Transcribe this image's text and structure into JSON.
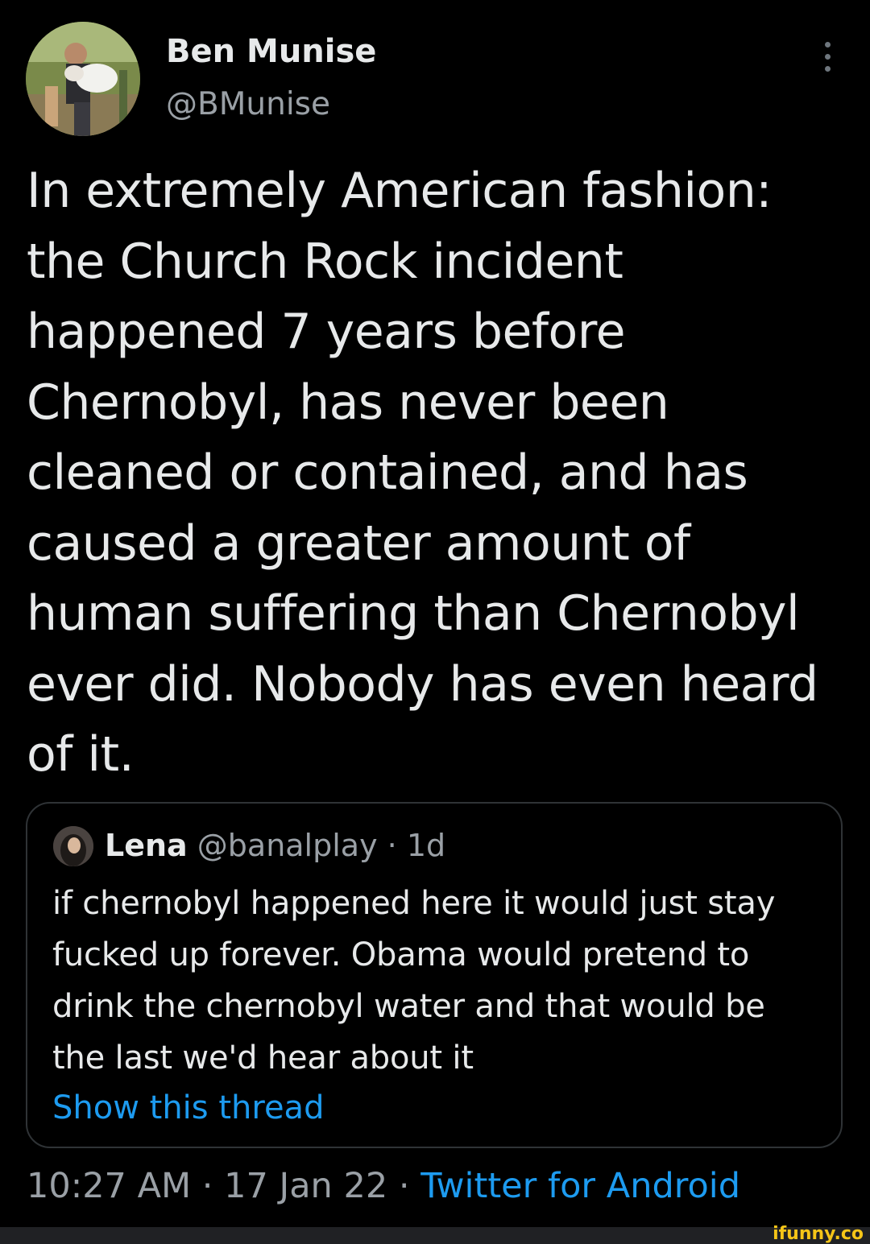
{
  "tweet": {
    "author": {
      "display_name": "Ben Munise",
      "handle": "@BMunise"
    },
    "text": "In extremely American fashion: the Church Rock incident happened 7 years before Chernobyl, has never been cleaned or contained, and has caused a greater amount of human suffering than Chernobyl ever did. Nobody has even heard of it.",
    "more_icon": "more-vertical-icon"
  },
  "quote": {
    "author_name": "Lena",
    "author_handle": "@banalplay",
    "separator": "·",
    "time": "1d",
    "text": "if chernobyl happened here it would just stay fucked up forever. Obama would pretend to drink the chernobyl water and that would be the last we'd hear about it",
    "show_thread": "Show this thread"
  },
  "meta": {
    "time": "10:27 AM",
    "separator": "·",
    "date": "17 Jan 22",
    "source": "Twitter for Android"
  },
  "watermark": "ifunny.co",
  "colors": {
    "background": "#000000",
    "text_primary": "#e7e9ea",
    "text_secondary": "#9aa0a6",
    "link": "#1d9bf0",
    "border": "#2f3336"
  }
}
